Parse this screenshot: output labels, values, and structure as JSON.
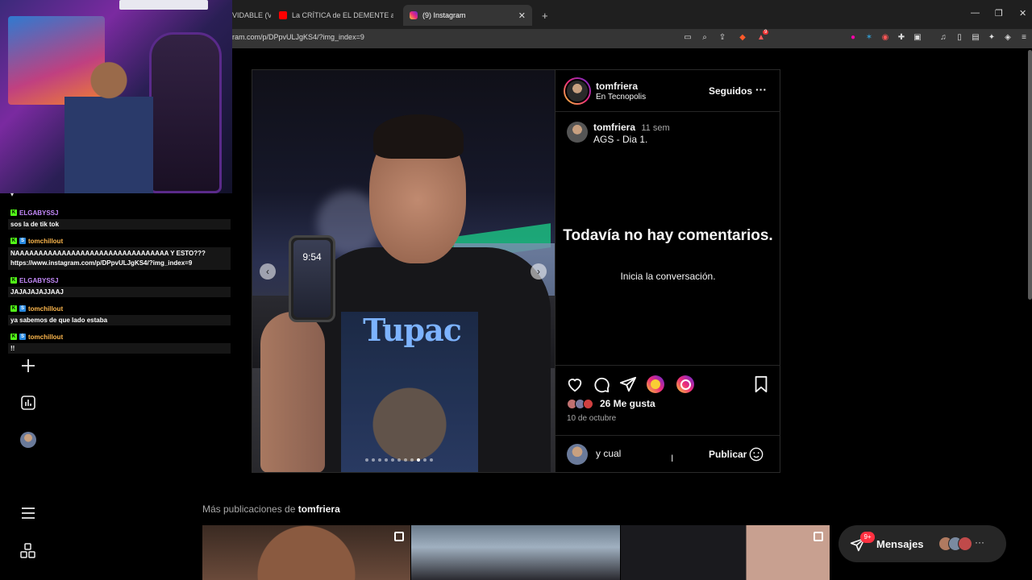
{
  "browser": {
    "tabs": [
      {
        "title": "VIDABLE (V...",
        "active": false
      },
      {
        "title": "La CRÍTICA de EL DEMENTE a BOFFE",
        "active": false
      },
      {
        "title": "(9) Instagram",
        "active": true
      }
    ],
    "new_tab": "+",
    "url": "ram.com/p/DPpvULJgKS4/?img_index=9",
    "extension_badge": "9"
  },
  "stream": {
    "chat": [
      {
        "user": "ELGABYSSJ",
        "user_color": "#c78cff",
        "text": "sos la de tik tok"
      },
      {
        "user": "tomchillout",
        "user_color": "#ffb84d",
        "text": "NAAAAAAAAAAAAAAAAAAAAAAAAAAAAAAAAA Y ESTO??? https://www.instagram.com/p/DPpvULJgKS4/?img_index=9"
      },
      {
        "user": "ELGABYSSJ",
        "user_color": "#c78cff",
        "text": "JAJAJAJAJJAAJ"
      },
      {
        "user": "tomchillout",
        "user_color": "#ffb84d",
        "text": "ya sabemos de que lado estaba"
      },
      {
        "user": "tomchillout",
        "user_color": "#ffb84d",
        "text": "!!"
      }
    ]
  },
  "post": {
    "author": "tomfriera",
    "location": "En Tecnopolis",
    "follow_label": "Seguidos",
    "caption_user": "tomfriera",
    "caption_age": "11 sem",
    "caption": "AGS - Dia 1.",
    "photo_phone_time": "9:54",
    "photo_shirt_text": "Tupac",
    "empty_title": "Todavía no hay comentarios.",
    "empty_sub": "Inicia la conversación.",
    "likes": "26 Me gusta",
    "date": "10 de octubre",
    "comment_value": "y cual",
    "publish_label": "Publicar"
  },
  "more": {
    "prefix": "Más publicaciones de ",
    "user": "tomfriera"
  },
  "messages": {
    "label": "Mensajes",
    "count": "9+"
  },
  "colors": {
    "ig_bg": "#000000",
    "badge_red": "#ff3040",
    "kick_green": "#53fc18"
  }
}
